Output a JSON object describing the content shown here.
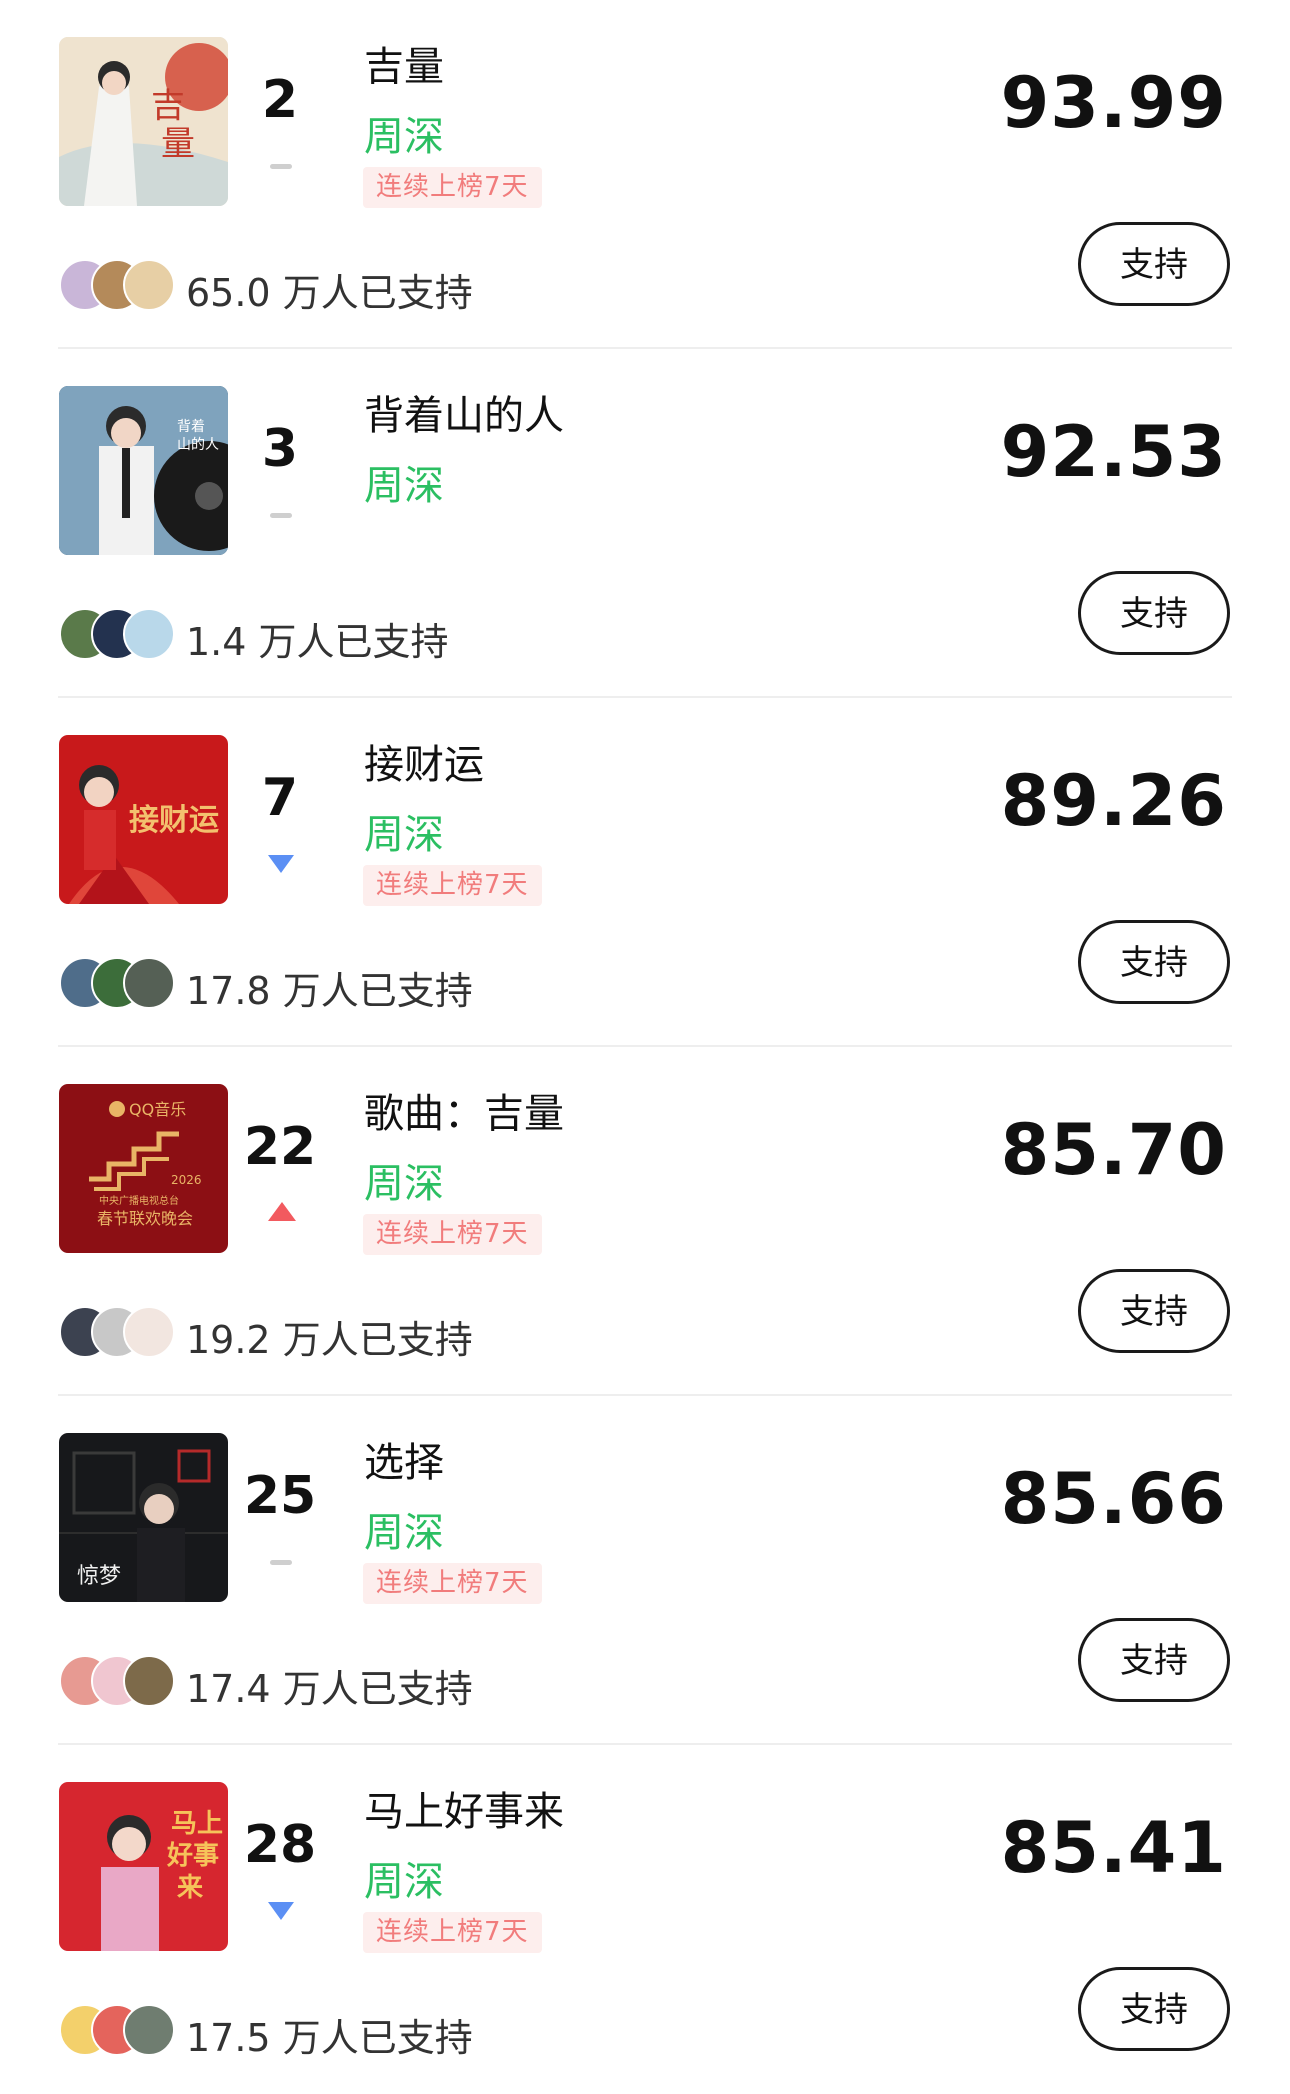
{
  "support_label": "支持",
  "items": [
    {
      "rank": "2",
      "trend": "flat",
      "title": "吉量",
      "artist": "周深",
      "badge": "连续上榜7天",
      "score": "93.99",
      "supporters": "65.0 万人已支持",
      "cover": {
        "bg": "#e8e4dc",
        "accent": "#d24a37",
        "art": "art-jiliang",
        "text": "吉量"
      },
      "avatars": [
        "#c9b6d8",
        "#b48a5a",
        "#e7cfa5"
      ]
    },
    {
      "rank": "3",
      "trend": "flat",
      "title": "背着山的人",
      "artist": "周深",
      "badge": "",
      "score": "92.53",
      "supporters": "1.4 万人已支持",
      "cover": {
        "bg": "#2f4a66",
        "accent": "#9fb6c8",
        "art": "art-mountain",
        "text": ""
      },
      "avatars": [
        "#5a7a4a",
        "#23324f",
        "#b9d8ea"
      ]
    },
    {
      "rank": "7",
      "trend": "down",
      "title": "接财运",
      "artist": "周深",
      "badge": "连续上榜7天",
      "score": "89.26",
      "supporters": "17.8 万人已支持",
      "cover": {
        "bg": "#c8191b",
        "accent": "#f3c06e",
        "art": "art-fortune",
        "text": "接财运"
      },
      "avatars": [
        "#4f6d8a",
        "#3c6d3a",
        "#556055"
      ]
    },
    {
      "rank": "22",
      "trend": "up",
      "title": "歌曲：吉量",
      "artist": "周深",
      "badge": "连续上榜7天",
      "score": "85.70",
      "supporters": "19.2 万人已支持",
      "cover": {
        "bg": "#8c0f14",
        "accent": "#e9b466",
        "art": "art-gala",
        "text": "QQ音乐"
      },
      "avatars": [
        "#3c4250",
        "#c8c8c8",
        "#f2e6e0"
      ]
    },
    {
      "rank": "25",
      "trend": "flat",
      "title": "选择",
      "artist": "周深",
      "badge": "连续上榜7天",
      "score": "85.66",
      "supporters": "17.4 万人已支持",
      "cover": {
        "bg": "#17181b",
        "accent": "#b52a2a",
        "art": "art-choice",
        "text": ""
      },
      "avatars": [
        "#e79a92",
        "#f0c6d0",
        "#7d6a4a"
      ]
    },
    {
      "rank": "28",
      "trend": "down",
      "title": "马上好事来",
      "artist": "周深",
      "badge": "连续上榜7天",
      "score": "85.41",
      "supporters": "17.5 万人已支持",
      "cover": {
        "bg": "#d6262f",
        "accent": "#f6c35a",
        "art": "art-horse",
        "text": "马上好事来"
      },
      "avatars": [
        "#f3d06b",
        "#e4645c",
        "#6f7d70"
      ]
    }
  ]
}
